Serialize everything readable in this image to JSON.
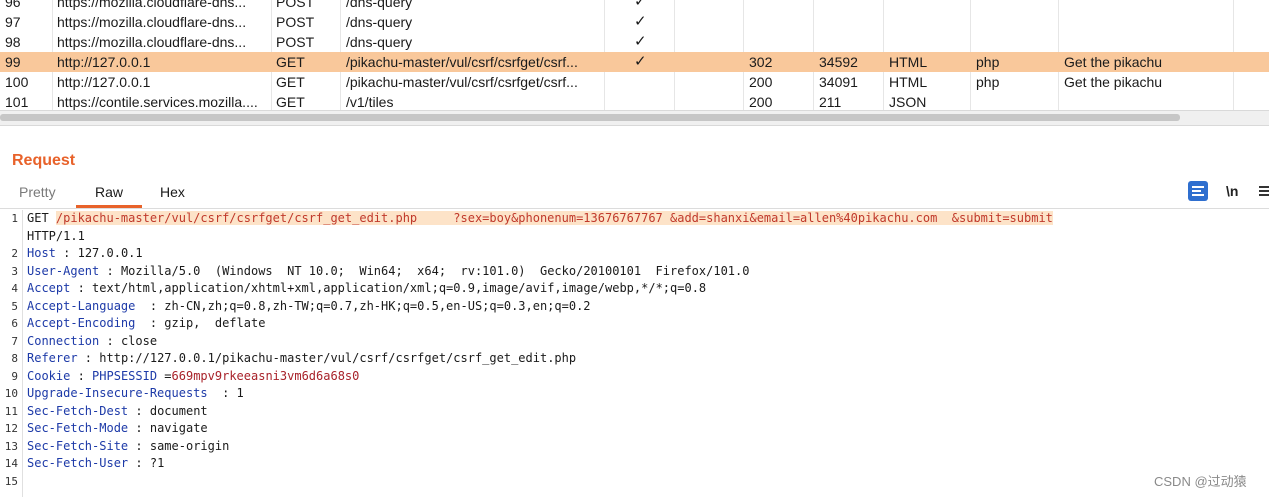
{
  "history": {
    "rows": [
      {
        "num": "96",
        "host": "https://mozilla.cloudflare-dns...",
        "method": "POST",
        "url": "/dns-query",
        "params": "✓",
        "status": "",
        "length": "",
        "mime": "",
        "ext": "",
        "title": ""
      },
      {
        "num": "97",
        "host": "https://mozilla.cloudflare-dns...",
        "method": "POST",
        "url": "/dns-query",
        "params": "✓",
        "status": "",
        "length": "",
        "mime": "",
        "ext": "",
        "title": ""
      },
      {
        "num": "98",
        "host": "https://mozilla.cloudflare-dns...",
        "method": "POST",
        "url": "/dns-query",
        "params": "✓",
        "status": "",
        "length": "",
        "mime": "",
        "ext": "",
        "title": ""
      },
      {
        "num": "99",
        "host": "http://127.0.0.1",
        "method": "GET",
        "url": "/pikachu-master/vul/csrf/csrfget/csrf...",
        "params": "✓",
        "status": "302",
        "length": "34592",
        "mime": "HTML",
        "ext": "php",
        "title": "Get the pikachu",
        "selected": true
      },
      {
        "num": "100",
        "host": "http://127.0.0.1",
        "method": "GET",
        "url": "/pikachu-master/vul/csrf/csrfget/csrf...",
        "params": "",
        "status": "200",
        "length": "34091",
        "mime": "HTML",
        "ext": "php",
        "title": "Get the pikachu"
      },
      {
        "num": "101",
        "host": "https://contile.services.mozilla....",
        "method": "GET",
        "url": "/v1/tiles",
        "params": "",
        "status": "200",
        "length": "211",
        "mime": "JSON",
        "ext": "",
        "title": ""
      }
    ],
    "selected_color": "#f9c89b"
  },
  "request": {
    "title": "Request",
    "tabs": {
      "pretty": "Pretty",
      "raw": "Raw",
      "hex": "Hex",
      "active": "raw"
    },
    "newline_toggle": "\\n",
    "icons": [
      "wrap-lines-icon",
      "newline-icon",
      "menu-icon"
    ],
    "accent_color": "#e8622a"
  },
  "editor": {
    "lines": [
      {
        "n": "1",
        "method": "GET ",
        "path": "/pikachu-master/vul/csrf/csrfget/csrf_get_edit.php     ",
        "query": "?sex=boy&phonenum=13676767767 &add=shanxi&email=allen%40pikachu.com  &submit=submit"
      },
      {
        "n": "",
        "text": "HTTP/1.1"
      },
      {
        "n": "2",
        "key": "Host",
        "sep": " : ",
        "val": "127.0.0.1"
      },
      {
        "n": "3",
        "key": "User-Agent",
        "sep": " : ",
        "val": "Mozilla/5.0  (Windows  NT 10.0;  Win64;  x64;  rv:101.0)  Gecko/20100101  Firefox/101.0"
      },
      {
        "n": "4",
        "key": "Accept",
        "sep": " : ",
        "val": "text/html,application/xhtml+xml,application/xml;q=0.9,image/avif,image/webp,*/*;q=0.8"
      },
      {
        "n": "5",
        "key": "Accept-Language",
        "sep": "  : ",
        "val": "zh-CN,zh;q=0.8,zh-TW;q=0.7,zh-HK;q=0.5,en-US;q=0.3,en;q=0.2"
      },
      {
        "n": "6",
        "key": "Accept-Encoding",
        "sep": "  : ",
        "val": "gzip,  deflate"
      },
      {
        "n": "7",
        "key": "Connection",
        "sep": " : ",
        "val": "close"
      },
      {
        "n": "8",
        "key": "Referer",
        "sep": " : ",
        "val": "http://127.0.0.1/pikachu-master/vul/csrf/csrfget/csrf_get_edit.php"
      },
      {
        "n": "9",
        "key": "Cookie",
        "sep": " : ",
        "cookie_name": "PHPSESSID",
        "cookie_eq": " =",
        "cookie_val": "669mpv9rkeeasni3vm6d6a68s0"
      },
      {
        "n": "10",
        "key": "Upgrade-Insecure-Requests",
        "sep": "  : ",
        "val": "1"
      },
      {
        "n": "11",
        "key": "Sec-Fetch-Dest",
        "sep": " : ",
        "val": "document"
      },
      {
        "n": "12",
        "key": "Sec-Fetch-Mode",
        "sep": " : ",
        "val": "navigate"
      },
      {
        "n": "13",
        "key": "Sec-Fetch-Site",
        "sep": " : ",
        "val": "same-origin"
      },
      {
        "n": "14",
        "key": "Sec-Fetch-User",
        "sep": " : ",
        "val": "?1"
      },
      {
        "n": "15",
        "text": ""
      }
    ]
  },
  "watermark": "CSDN @过动猿"
}
